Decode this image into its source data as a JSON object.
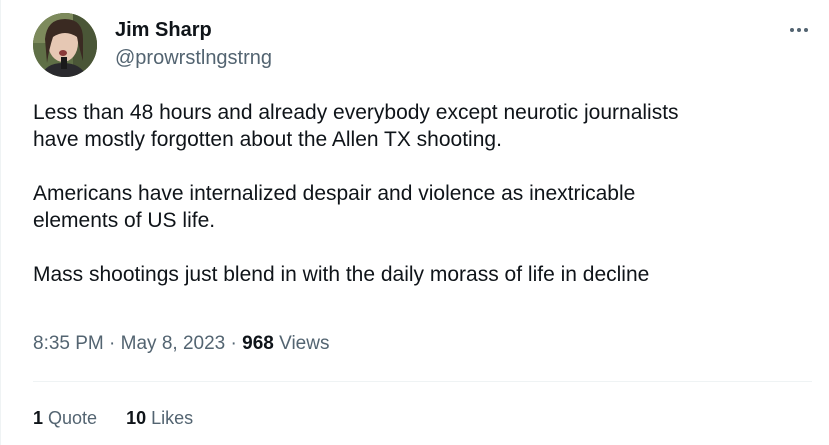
{
  "author": {
    "name": "Jim Sharp",
    "handle": "@prowrstlngstrng"
  },
  "tweet": {
    "paragraphs": [
      "Less than 48 hours and already everybody except neurotic journalists\nhave mostly forgotten about the Allen TX shooting.",
      "Americans have internalized despair and violence as inextricable\nelements of US life.",
      "Mass shootings just blend in with the daily morass of life in decline"
    ],
    "time": "8:35 PM",
    "date": "May 8, 2023",
    "views_count": "968",
    "views_label": "Views"
  },
  "stats": {
    "quotes_count": "1",
    "quotes_label": "Quote",
    "likes_count": "10",
    "likes_label": "Likes"
  },
  "icons": {
    "more": "more-horizontal-icon"
  },
  "colors": {
    "text_primary": "#0f1419",
    "text_secondary": "#536471",
    "divider": "#eff3f4"
  }
}
